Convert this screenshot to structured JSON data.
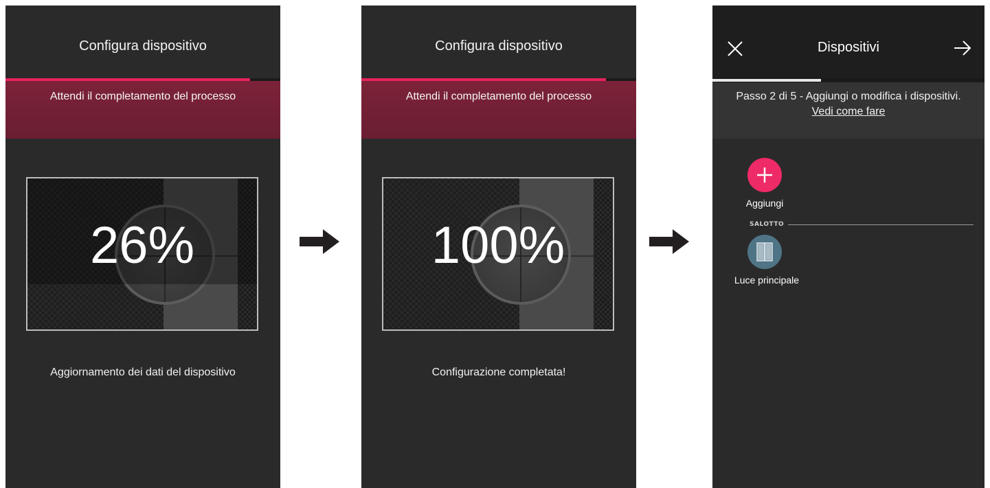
{
  "screens": [
    {
      "title": "Configura dispositivo",
      "banner": "Attendi il completamento del processo",
      "percent": "26%",
      "progress": 0.89,
      "status": "Aggiornamento dei dati del dispositivo"
    },
    {
      "title": "Configura dispositivo",
      "banner": "Attendi il completamento del processo",
      "percent": "100%",
      "progress": 0.89,
      "status": "Configurazione completata!"
    }
  ],
  "devices_screen": {
    "title": "Dispositivi",
    "close_icon": "close-icon",
    "next_icon": "arrow-right-icon",
    "step_progress": 0.4,
    "step_text": "Passo 2 di 5 - Aggiungi o modifica i dispositivi.",
    "help_link": "Vedi come fare",
    "add_label": "Aggiungi",
    "section": "SALOTTO",
    "device_label": "Luce principale"
  },
  "colors": {
    "accent": "#ee2a67",
    "banner": "#6f1f33",
    "screen_bg": "#2b2a2b",
    "device_icon_bg": "#4f7486"
  }
}
